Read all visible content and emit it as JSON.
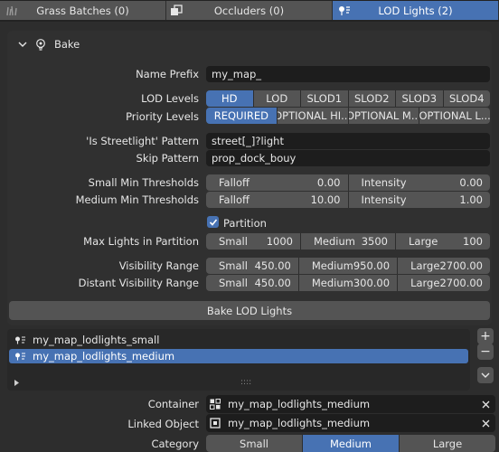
{
  "tabs": [
    {
      "label": "Grass Batches (0)",
      "active": false,
      "icon": "grass-icon"
    },
    {
      "label": "Occluders (0)",
      "active": false,
      "icon": "occluder-icon"
    },
    {
      "label": "LOD Lights (2)",
      "active": true,
      "icon": "light-icon"
    }
  ],
  "panel": {
    "title": "Bake"
  },
  "name_prefix": {
    "label": "Name Prefix",
    "value": "my_map_"
  },
  "lod_levels": {
    "label": "LOD Levels",
    "options": [
      "HD",
      "LOD",
      "SLOD1",
      "SLOD2",
      "SLOD3",
      "SLOD4"
    ],
    "selected": "HD"
  },
  "priority_levels": {
    "label": "Priority Levels",
    "options": [
      "REQUIRED",
      "OPTIONAL HI...",
      "OPTIONAL M...",
      "OPTIONAL L..."
    ],
    "selected": "REQUIRED"
  },
  "streetlight_pattern": {
    "label": "'Is Streetlight' Pattern",
    "value": "street[_]?light"
  },
  "skip_pattern": {
    "label": "Skip Pattern",
    "value": "prop_dock_bouy"
  },
  "small_min": {
    "label": "Small Min Thresholds",
    "falloff_label": "Falloff",
    "falloff": "0.00",
    "intensity_label": "Intensity",
    "intensity": "0.00"
  },
  "medium_min": {
    "label": "Medium Min Thresholds",
    "falloff_label": "Falloff",
    "falloff": "10.00",
    "intensity_label": "Intensity",
    "intensity": "1.00"
  },
  "partition": {
    "label": "Partition",
    "checked": true
  },
  "max_lights": {
    "label": "Max Lights in Partition",
    "small_label": "Small",
    "small": "1000",
    "medium_label": "Medium",
    "medium": "3500",
    "large_label": "Large",
    "large": "100"
  },
  "visibility_range": {
    "label": "Visibility Range",
    "small_label": "Small",
    "small": "450.00",
    "medium_label": "Medium",
    "medium": "950.00",
    "large_label": "Large",
    "large": "2700.00"
  },
  "distant_visibility_range": {
    "label": "Distant Visibility Range",
    "small_label": "Small",
    "small": "450.00",
    "medium_label": "Medium",
    "medium": "300.00",
    "large_label": "Large",
    "large": "2700.00"
  },
  "bake_button": "Bake LOD Lights",
  "list": {
    "items": [
      {
        "label": "my_map_lodlights_small",
        "selected": false
      },
      {
        "label": "my_map_lodlights_medium",
        "selected": true
      }
    ],
    "grip": "::::",
    "add": "+",
    "remove": "−"
  },
  "container": {
    "label": "Container",
    "value": "my_map_lodlights_medium"
  },
  "linked_object": {
    "label": "Linked Object",
    "value": "my_map_lodlights_medium"
  },
  "category": {
    "label": "Category",
    "options": [
      "Small",
      "Medium",
      "Large"
    ],
    "selected": "Medium"
  },
  "colors": {
    "accent": "#4772b3",
    "background": "#2d2d2d",
    "widget": "#545454",
    "field": "#1d1d1d"
  }
}
